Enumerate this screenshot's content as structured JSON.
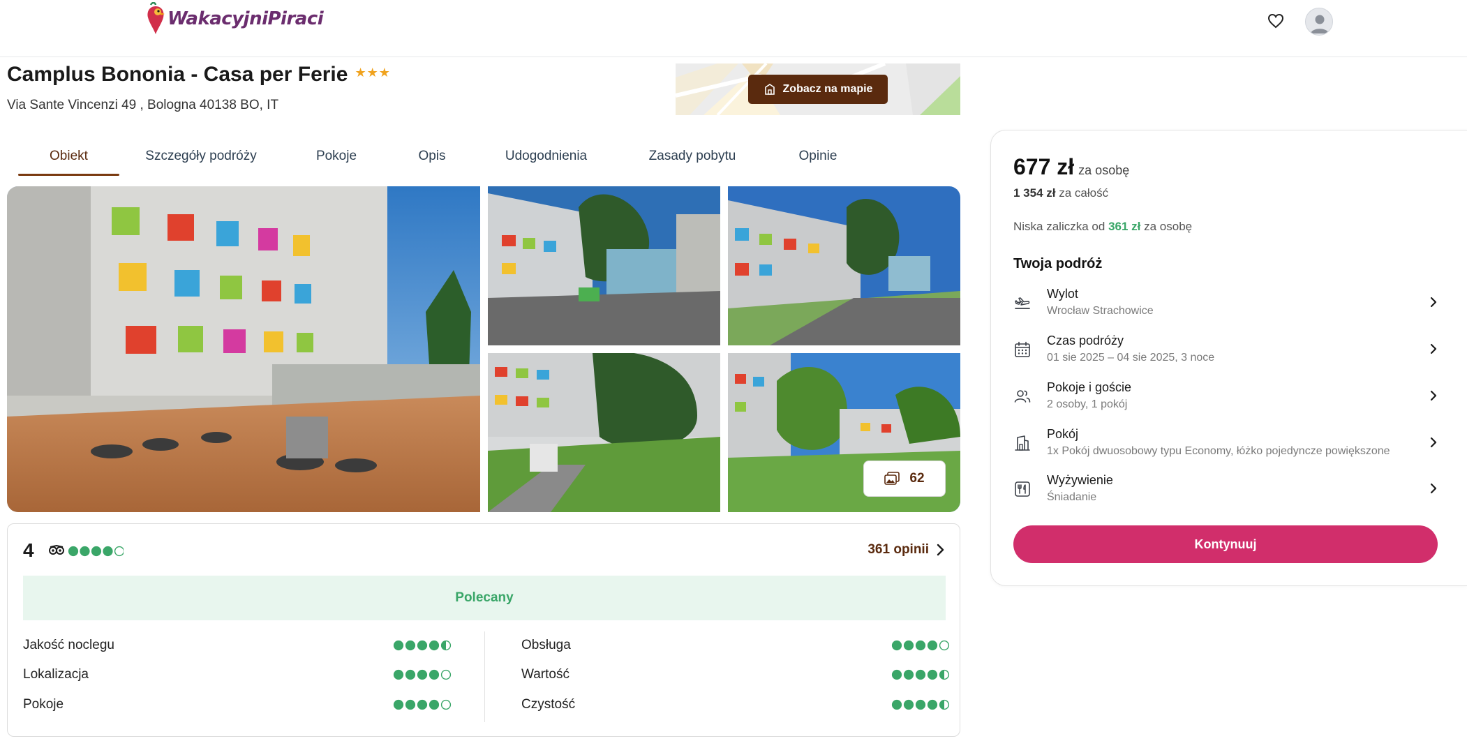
{
  "header": {
    "logo_text": "WakacyjniPiraci",
    "favorites_icon": "heart-icon",
    "account_icon": "user-avatar-icon"
  },
  "hotel": {
    "name": "Camplus Bononia - Casa per Ferie",
    "stars": "★★★",
    "address": "Via Sante Vincenzi 49 , Bologna 40138 BO, IT"
  },
  "map": {
    "button_label": "Zobacz na mapie"
  },
  "tabs": [
    {
      "label": "Obiekt",
      "active": true
    },
    {
      "label": "Szczegóły podróży"
    },
    {
      "label": "Pokoje"
    },
    {
      "label": "Opis"
    },
    {
      "label": "Udogodnienia"
    },
    {
      "label": "Zasady pobytu"
    },
    {
      "label": "Opinie"
    }
  ],
  "gallery": {
    "photo_count": "62"
  },
  "reviews": {
    "score": "4",
    "score_bubbles": 4,
    "link_label": "361 opinii",
    "badge": "Polecany",
    "categories": [
      {
        "label": "Jakość noclegu",
        "rating": 4.5
      },
      {
        "label": "Lokalizacja",
        "rating": 4
      },
      {
        "label": "Pokoje",
        "rating": 4
      },
      {
        "label": "Obsługa",
        "rating": 4
      },
      {
        "label": "Wartość",
        "rating": 4.5
      },
      {
        "label": "Czystość",
        "rating": 4.5
      }
    ]
  },
  "booking": {
    "price": "677 zł",
    "price_suffix": "za osobę",
    "total_amount": "1 354 zł",
    "total_suffix": "za całość",
    "deposit_prefix": "Niska zaliczka od",
    "deposit_amount": "361 zł",
    "deposit_suffix": "za osobę",
    "trip_title": "Twoja podróż",
    "rows": [
      {
        "icon": "plane-departure-icon",
        "label": "Wylot",
        "value": "Wrocław Strachowice"
      },
      {
        "icon": "calendar-icon",
        "label": "Czas podróży",
        "value": "01 sie 2025 – 04 sie 2025, 3 noce"
      },
      {
        "icon": "users-icon",
        "label": "Pokoje i goście",
        "value": "2 osoby, 1 pokój"
      },
      {
        "icon": "building-icon",
        "label": "Pokój",
        "value": "1x Pokój dwuosobowy typu Economy, łóżko pojedyncze powiększone"
      },
      {
        "icon": "fork-knife-icon",
        "label": "Wyżywienie",
        "value": "Śniadanie"
      }
    ],
    "continue_label": "Kontynuuj"
  },
  "colors": {
    "brand_dark": "#5a2a0e",
    "accent_pink": "#d12e6b",
    "rating_green": "#3aa668",
    "star_orange": "#f0a21d"
  }
}
